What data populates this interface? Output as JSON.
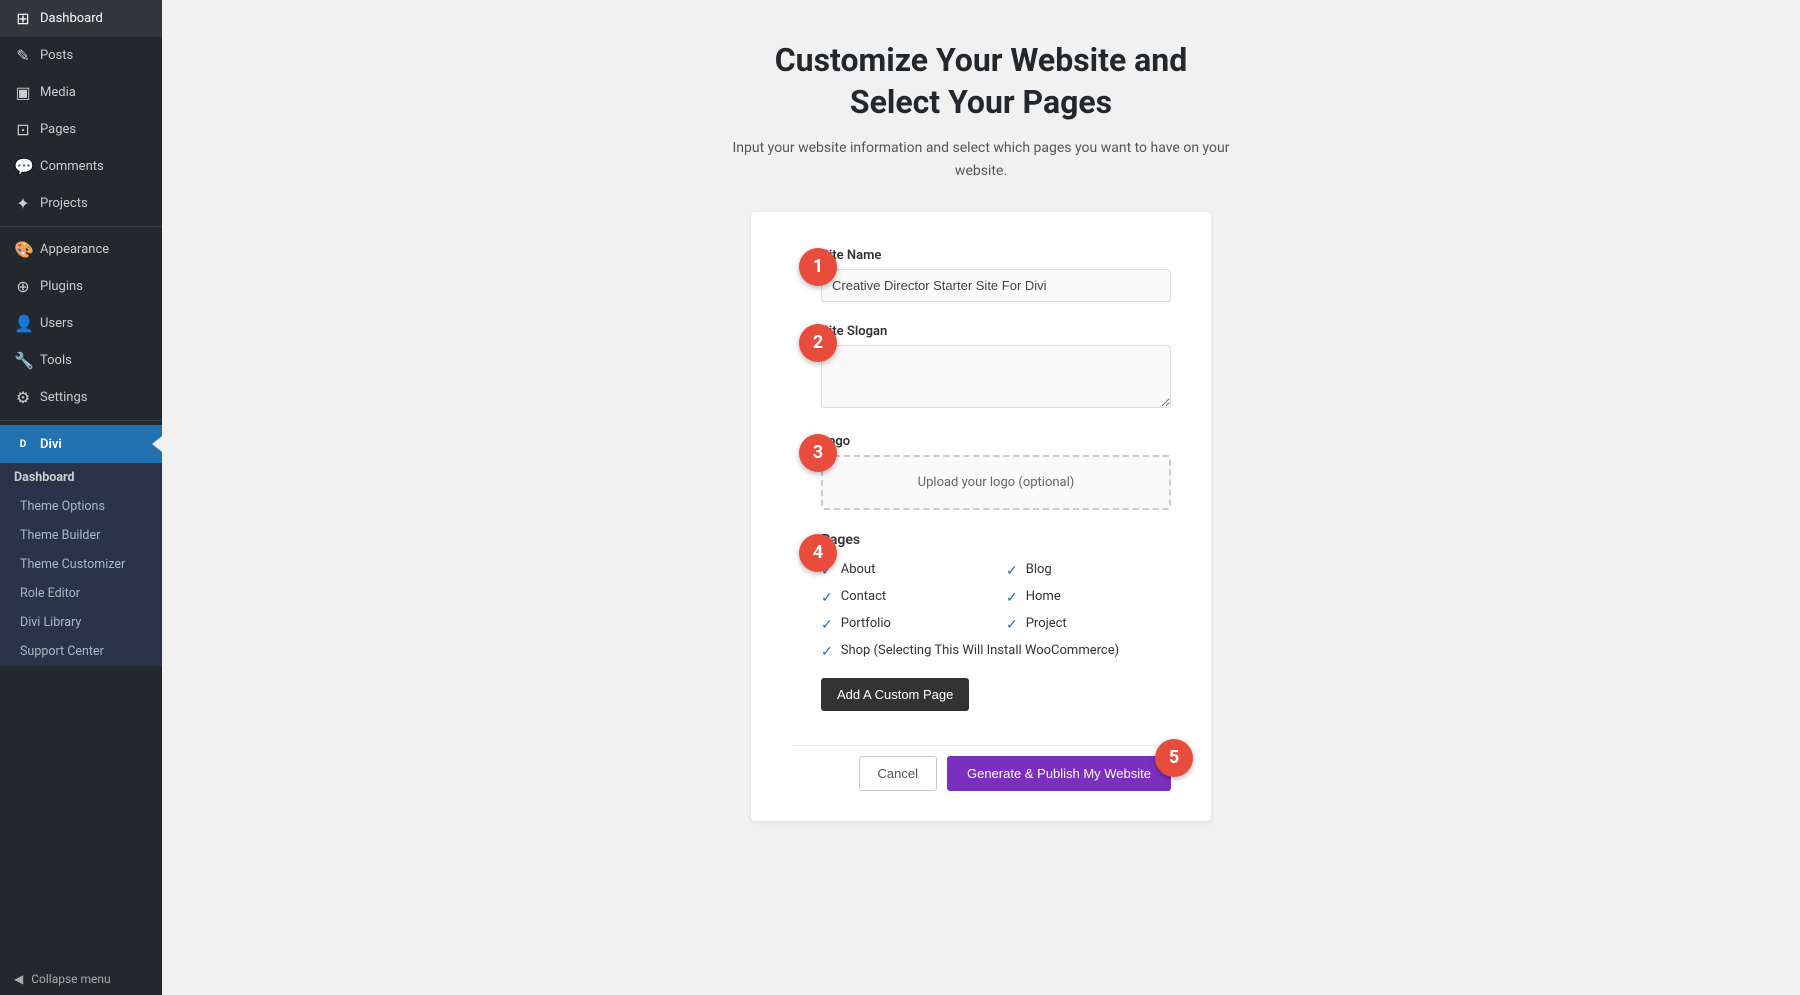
{
  "sidebar": {
    "items": [
      {
        "label": "Dashboard",
        "icon": "⊞"
      },
      {
        "label": "Posts",
        "icon": "✎"
      },
      {
        "label": "Media",
        "icon": "▣"
      },
      {
        "label": "Pages",
        "icon": "⊡"
      },
      {
        "label": "Comments",
        "icon": "💬"
      },
      {
        "label": "Projects",
        "icon": "✦"
      },
      {
        "label": "Appearance",
        "icon": "🎨"
      },
      {
        "label": "Plugins",
        "icon": "⊕"
      },
      {
        "label": "Users",
        "icon": "👤"
      },
      {
        "label": "Tools",
        "icon": "🔧"
      },
      {
        "label": "Settings",
        "icon": "⚙"
      }
    ],
    "divi": {
      "label": "Divi",
      "sub_items": [
        {
          "label": "Dashboard",
          "bold": true
        },
        {
          "label": "Theme Options"
        },
        {
          "label": "Theme Builder"
        },
        {
          "label": "Theme Customizer"
        },
        {
          "label": "Role Editor"
        },
        {
          "label": "Divi Library"
        },
        {
          "label": "Support Center"
        }
      ]
    },
    "collapse_label": "Collapse menu"
  },
  "main": {
    "title_line1": "Customize Your Website and",
    "title_line2": "Select Your Pages",
    "subtitle": "Input your website information and select which pages you want to have on your website.",
    "form": {
      "site_name_label": "Site Name",
      "site_name_value": "Creative Director Starter Site For Divi",
      "site_slogan_label": "Site Slogan",
      "site_slogan_placeholder": "",
      "logo_label": "Logo",
      "logo_upload_text": "Upload your logo (optional)",
      "pages_label": "Pages",
      "pages": [
        {
          "label": "About",
          "checked": true
        },
        {
          "label": "Blog",
          "checked": true
        },
        {
          "label": "Contact",
          "checked": true
        },
        {
          "label": "Home",
          "checked": true
        },
        {
          "label": "Portfolio",
          "checked": true
        },
        {
          "label": "Project",
          "checked": true
        },
        {
          "label": "Shop (Selecting This Will Install WooCommerce)",
          "checked": true,
          "full_row": true
        }
      ],
      "add_custom_page_label": "Add A Custom Page",
      "cancel_label": "Cancel",
      "publish_label": "Generate & Publish My Website"
    },
    "steps": [
      "1",
      "2",
      "3",
      "4",
      "5"
    ]
  }
}
